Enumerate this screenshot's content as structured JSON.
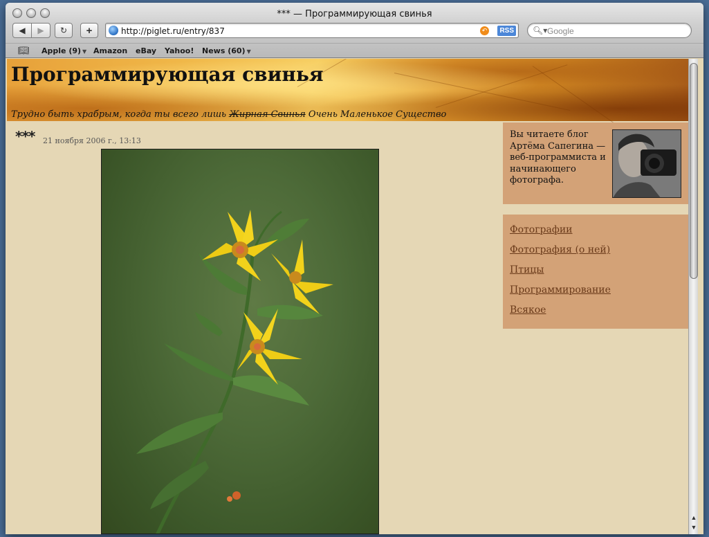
{
  "window": {
    "title": "*** — Программирующая свинья"
  },
  "toolbar": {
    "back_icon": "◀",
    "forward_icon": "▶",
    "reload_icon": "↻",
    "add_icon": "+",
    "url": "http://piglet.ru/entry/837",
    "rss_label": "RSS",
    "search_placeholder": "Google"
  },
  "bookmarks": [
    {
      "label": "Apple (9)",
      "menu": true
    },
    {
      "label": "Amazon",
      "menu": false
    },
    {
      "label": "eBay",
      "menu": false
    },
    {
      "label": "Yahoo!",
      "menu": false
    },
    {
      "label": "News (60)",
      "menu": true
    }
  ],
  "blog": {
    "title": "Программирующая свинья",
    "subtitle_before": "Трудно быть храбрым, когда ты всего лишь ",
    "subtitle_struck": "Жирная Свинья",
    "subtitle_after": " Очень Маленькое Существо"
  },
  "post": {
    "title": "***",
    "date": "21 ноября 2006 г., 13:13"
  },
  "sidebar": {
    "about_text": "Вы читаете блог Артёма Сапегина — веб-программиста и начинающего фотографа.",
    "categories": [
      "Фотографии",
      "Фотография (о ней)",
      "Птицы",
      "Программирование",
      "Всякое"
    ]
  },
  "colors": {
    "page_bg": "#e5d7b5",
    "sidebar_bg": "#d3a277",
    "link": "#6a3a1a"
  }
}
